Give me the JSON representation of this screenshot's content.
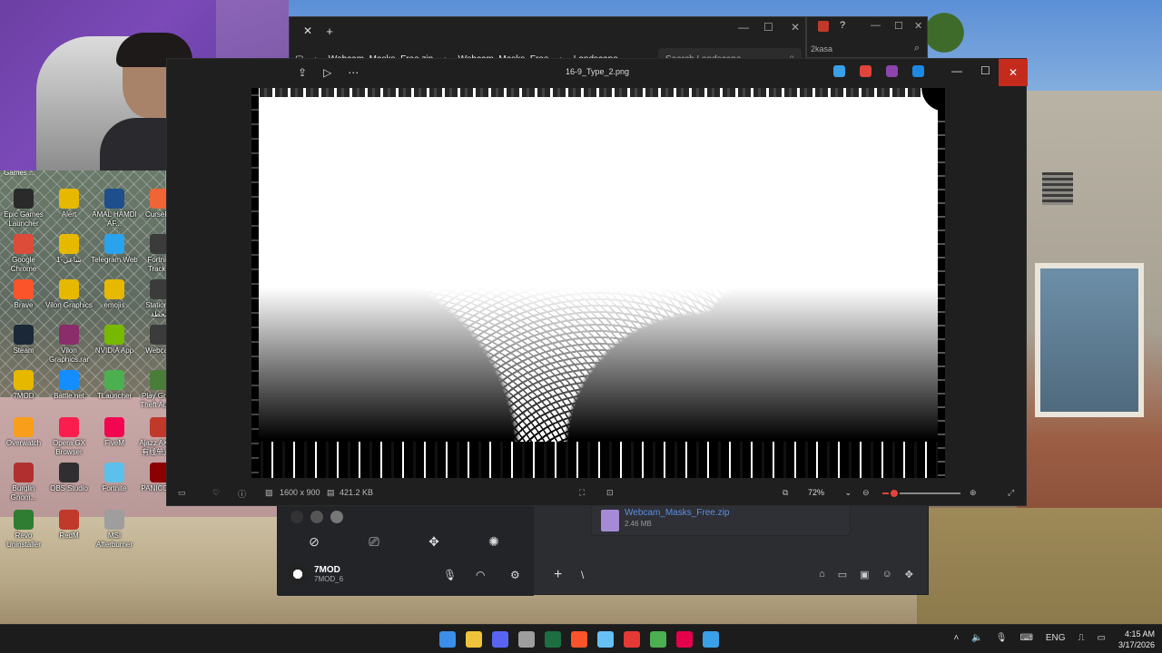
{
  "desktop": {
    "top_label": "Games ...",
    "icons": [
      {
        "label": "Epic Games Launcher",
        "color": "#2a2a2a"
      },
      {
        "label": "Alert",
        "color": "#e6b800"
      },
      {
        "label": "AMAL HAMDI AF...",
        "color": "#1f4e8c"
      },
      {
        "label": "CurseF...",
        "color": "#f16436"
      },
      {
        "label": "Google Chrome",
        "color": "#dd4b39"
      },
      {
        "label": "ساعي-1",
        "color": "#e6b800"
      },
      {
        "label": "Telegram Web",
        "color": "#2aa3ef"
      },
      {
        "label": "Fortni... Track...",
        "color": "#3b3b3b"
      },
      {
        "label": "Brave",
        "color": "#fb542b"
      },
      {
        "label": "Vilon Graphics",
        "color": "#e6b800"
      },
      {
        "label": "emojis",
        "color": "#e6b800"
      },
      {
        "label": "Station 0 محطة",
        "color": "#3b3b3b"
      },
      {
        "label": "Steam",
        "color": "#1b2838"
      },
      {
        "label": "Vilon Graphics.rar",
        "color": "#8b2d6b"
      },
      {
        "label": "NVIDIA App",
        "color": "#76b900"
      },
      {
        "label": "Webca...",
        "color": "#3b3b3b"
      },
      {
        "label": "7MOD",
        "color": "#e6b800"
      },
      {
        "label": "Battle.net",
        "color": "#148eff"
      },
      {
        "label": "TLauncher",
        "color": "#4caf50"
      },
      {
        "label": "Play Grand Theft Auto...",
        "color": "#4a7d3a"
      },
      {
        "label": "Overwatch",
        "color": "#f99e1a"
      },
      {
        "label": "Opera GX Browser",
        "color": "#fa1e4e"
      },
      {
        "label": "FiveM",
        "color": "#f40552"
      },
      {
        "label": "Ajazz AK820 有线单光版",
        "color": "#c0392b"
      },
      {
        "label": "Burglin Gnom...",
        "color": "#b03030"
      },
      {
        "label": "OBS Studio",
        "color": "#302e31"
      },
      {
        "label": "Fortnite",
        "color": "#5bc0eb"
      },
      {
        "label": "PANICORE",
        "color": "#8b0000"
      },
      {
        "label": "Revo Uninstaller",
        "color": "#2e7d32"
      },
      {
        "label": "RedM",
        "color": "#c0392b"
      },
      {
        "label": "MSI Afterburner",
        "color": "#9e9e9e"
      }
    ]
  },
  "explorer": {
    "breadcrumbs": [
      "Webcam_Masks_Free.zip",
      "Webcam_Masks_Free",
      "Landscape"
    ],
    "search_placeholder": "Search Landscape",
    "tab_close": "✕",
    "tab_add": "+",
    "minimize": "—",
    "maximize": "☐",
    "close": "✕"
  },
  "right_window": {
    "search_text": "2kasa",
    "minimize": "—",
    "maximize": "☐",
    "close": "✕"
  },
  "photos": {
    "filename": "16-9_Type_2.png",
    "dimensions": "1600 x 900",
    "filesize": "421.2 KB",
    "zoom": "72%",
    "zoom_fraction": 0.15,
    "minimize": "—",
    "maximize": "☐",
    "close": "✕"
  },
  "discord": {
    "username": "7MOD",
    "status": "7MOD_6",
    "attachment_name": "Webcam_Masks_Free.zip",
    "attachment_size": "2.46 MB",
    "plus": "+",
    "slash": "\\"
  },
  "taskbar": {
    "language": "ENG",
    "time": "4:15 AM",
    "date": "3/17/2026",
    "apps": [
      {
        "name": "start",
        "color": "#3b8eea"
      },
      {
        "name": "file-explorer",
        "color": "#f0c43a"
      },
      {
        "name": "discord",
        "color": "#5865f2"
      },
      {
        "name": "browser",
        "color": "#9e9e9e"
      },
      {
        "name": "excel",
        "color": "#1d6f42"
      },
      {
        "name": "brave",
        "color": "#fb542b"
      },
      {
        "name": "steam",
        "color": "#66c0f4"
      },
      {
        "name": "launcher",
        "color": "#e53935"
      },
      {
        "name": "minecraft",
        "color": "#4caf50"
      },
      {
        "name": "adobe",
        "color": "#e5004b"
      },
      {
        "name": "photos",
        "color": "#3aa0e8"
      }
    ]
  }
}
